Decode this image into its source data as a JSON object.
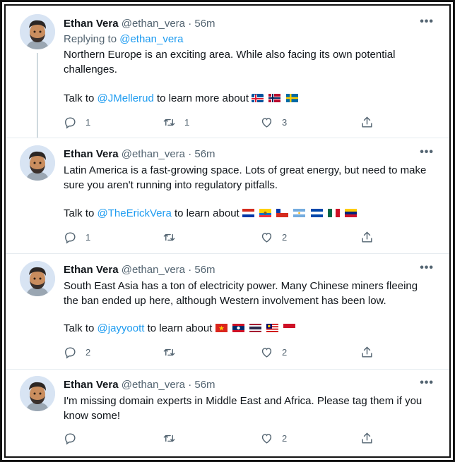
{
  "tweets": [
    {
      "name": "Ethan Vera",
      "handle": "@ethan_vera",
      "dot": "·",
      "time": "56m",
      "replying_label": "Replying to",
      "replying_handle": "@ethan_vera",
      "text": "Northern Europe is an exciting area. While also facing its own potential challenges.",
      "talk_prefix": "Talk to",
      "talk_handle": "@JMellerud",
      "talk_suffix": "to learn more about",
      "flags": [
        "iceland",
        "norway",
        "sweden"
      ],
      "replies": "1",
      "retweets": "1",
      "likes": "3"
    },
    {
      "name": "Ethan Vera",
      "handle": "@ethan_vera",
      "dot": "·",
      "time": "56m",
      "text": "Latin America is a fast-growing space. Lots of great energy, but need to make sure you aren't running into regulatory pitfalls.",
      "talk_prefix": "Talk to",
      "talk_handle": "@TheErickVera",
      "talk_suffix": "to learn about",
      "flags": [
        "paraguay",
        "ecuador",
        "chile",
        "argentina",
        "el-salvador",
        "mexico",
        "venezuela"
      ],
      "replies": "1",
      "retweets": "",
      "likes": "2"
    },
    {
      "name": "Ethan Vera",
      "handle": "@ethan_vera",
      "dot": "·",
      "time": "56m",
      "text": "South East Asia has a ton of electricity power. Many Chinese miners fleeing the ban ended up here, although Western involvement has been low.",
      "talk_prefix": "Talk to",
      "talk_handle": "@jayyoott",
      "talk_suffix": "to learn about",
      "flags": [
        "vietnam",
        "laos",
        "thailand",
        "malaysia",
        "indonesia"
      ],
      "replies": "2",
      "retweets": "",
      "likes": "2"
    },
    {
      "name": "Ethan Vera",
      "handle": "@ethan_vera",
      "dot": "·",
      "time": "56m",
      "text": "I'm missing domain experts in Middle East and Africa. Please tag them if you know some!",
      "replies": "",
      "retweets": "",
      "likes": "2"
    }
  ],
  "icons": {
    "more": "more-icon",
    "reply": "reply-icon",
    "retweet": "retweet-icon",
    "like": "heart-icon",
    "share": "share-icon"
  },
  "colors": {
    "link": "#1d9bf0",
    "muted": "#536471",
    "text": "#0f1419"
  }
}
